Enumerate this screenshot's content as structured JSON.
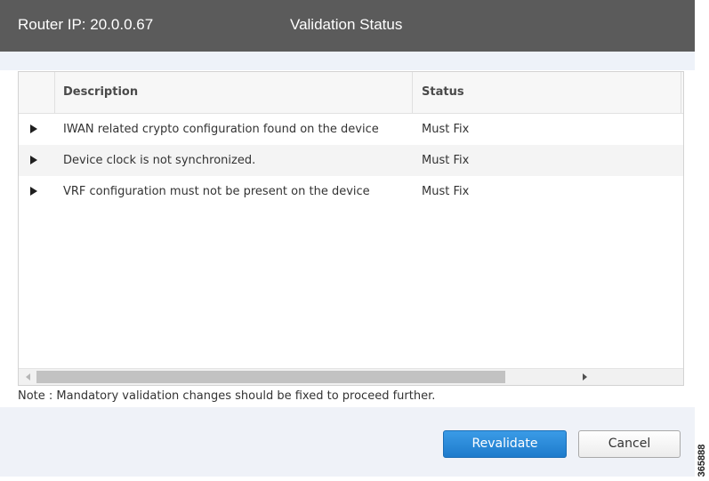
{
  "header": {
    "router_ip": "Router IP: 20.0.0.67",
    "title": "Validation Status"
  },
  "table": {
    "columns": [
      "Description",
      "Status"
    ],
    "rows": [
      {
        "description": "IWAN related crypto configuration found on the device",
        "status": "Must Fix"
      },
      {
        "description": "Device clock is not synchronized.",
        "status": "Must Fix"
      },
      {
        "description": "VRF configuration must not be present on the device",
        "status": "Must Fix"
      }
    ]
  },
  "note": "Note : Mandatory validation changes should be fixed to proceed further.",
  "buttons": {
    "revalidate": "Revalidate",
    "cancel": "Cancel"
  },
  "figure_number": "365888",
  "colors": {
    "header_bg": "#5b5b5b",
    "primary_button": "#2a8ad9",
    "panel_bg": "#eff2f8"
  }
}
